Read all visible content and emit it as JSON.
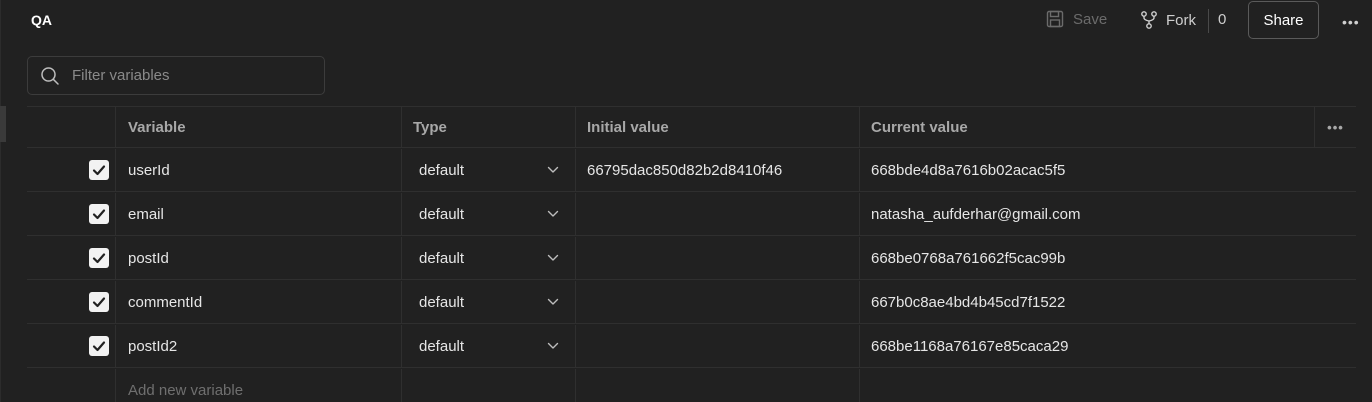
{
  "header": {
    "title": "QA",
    "save_label": "Save",
    "fork_label": "Fork",
    "fork_count": "0",
    "share_label": "Share"
  },
  "filter": {
    "placeholder": "Filter variables",
    "value": ""
  },
  "table": {
    "columns": {
      "variable": "Variable",
      "type": "Type",
      "initial_value": "Initial value",
      "current_value": "Current value"
    },
    "rows": [
      {
        "checked": true,
        "variable": "userId",
        "type": "default",
        "initial_value": "66795dac850d82b2d8410f46",
        "current_value": "668bde4d8a7616b02acac5f5"
      },
      {
        "checked": true,
        "variable": "email",
        "type": "default",
        "initial_value": "",
        "current_value": "natasha_aufderhar@gmail.com"
      },
      {
        "checked": true,
        "variable": "postId",
        "type": "default",
        "initial_value": "",
        "current_value": "668be0768a761662f5cac99b"
      },
      {
        "checked": true,
        "variable": "commentId",
        "type": "default",
        "initial_value": "",
        "current_value": "667b0c8ae4bd4b45cd7f1522"
      },
      {
        "checked": true,
        "variable": "postId2",
        "type": "default",
        "initial_value": "",
        "current_value": "668be1168a76167e85caca29"
      }
    ],
    "add_placeholder": "Add new variable"
  },
  "icons": {
    "save": "save-icon",
    "fork": "fork-icon",
    "more": "more-horizontal-icon",
    "search": "search-icon",
    "check": "check-icon",
    "chevron": "chevron-down-icon"
  },
  "colors": {
    "background": "#212121",
    "border": "#2f2f2f",
    "text": "#e6e6e6",
    "muted": "#a8a8a8",
    "checkbox": "#f2f2f2"
  }
}
